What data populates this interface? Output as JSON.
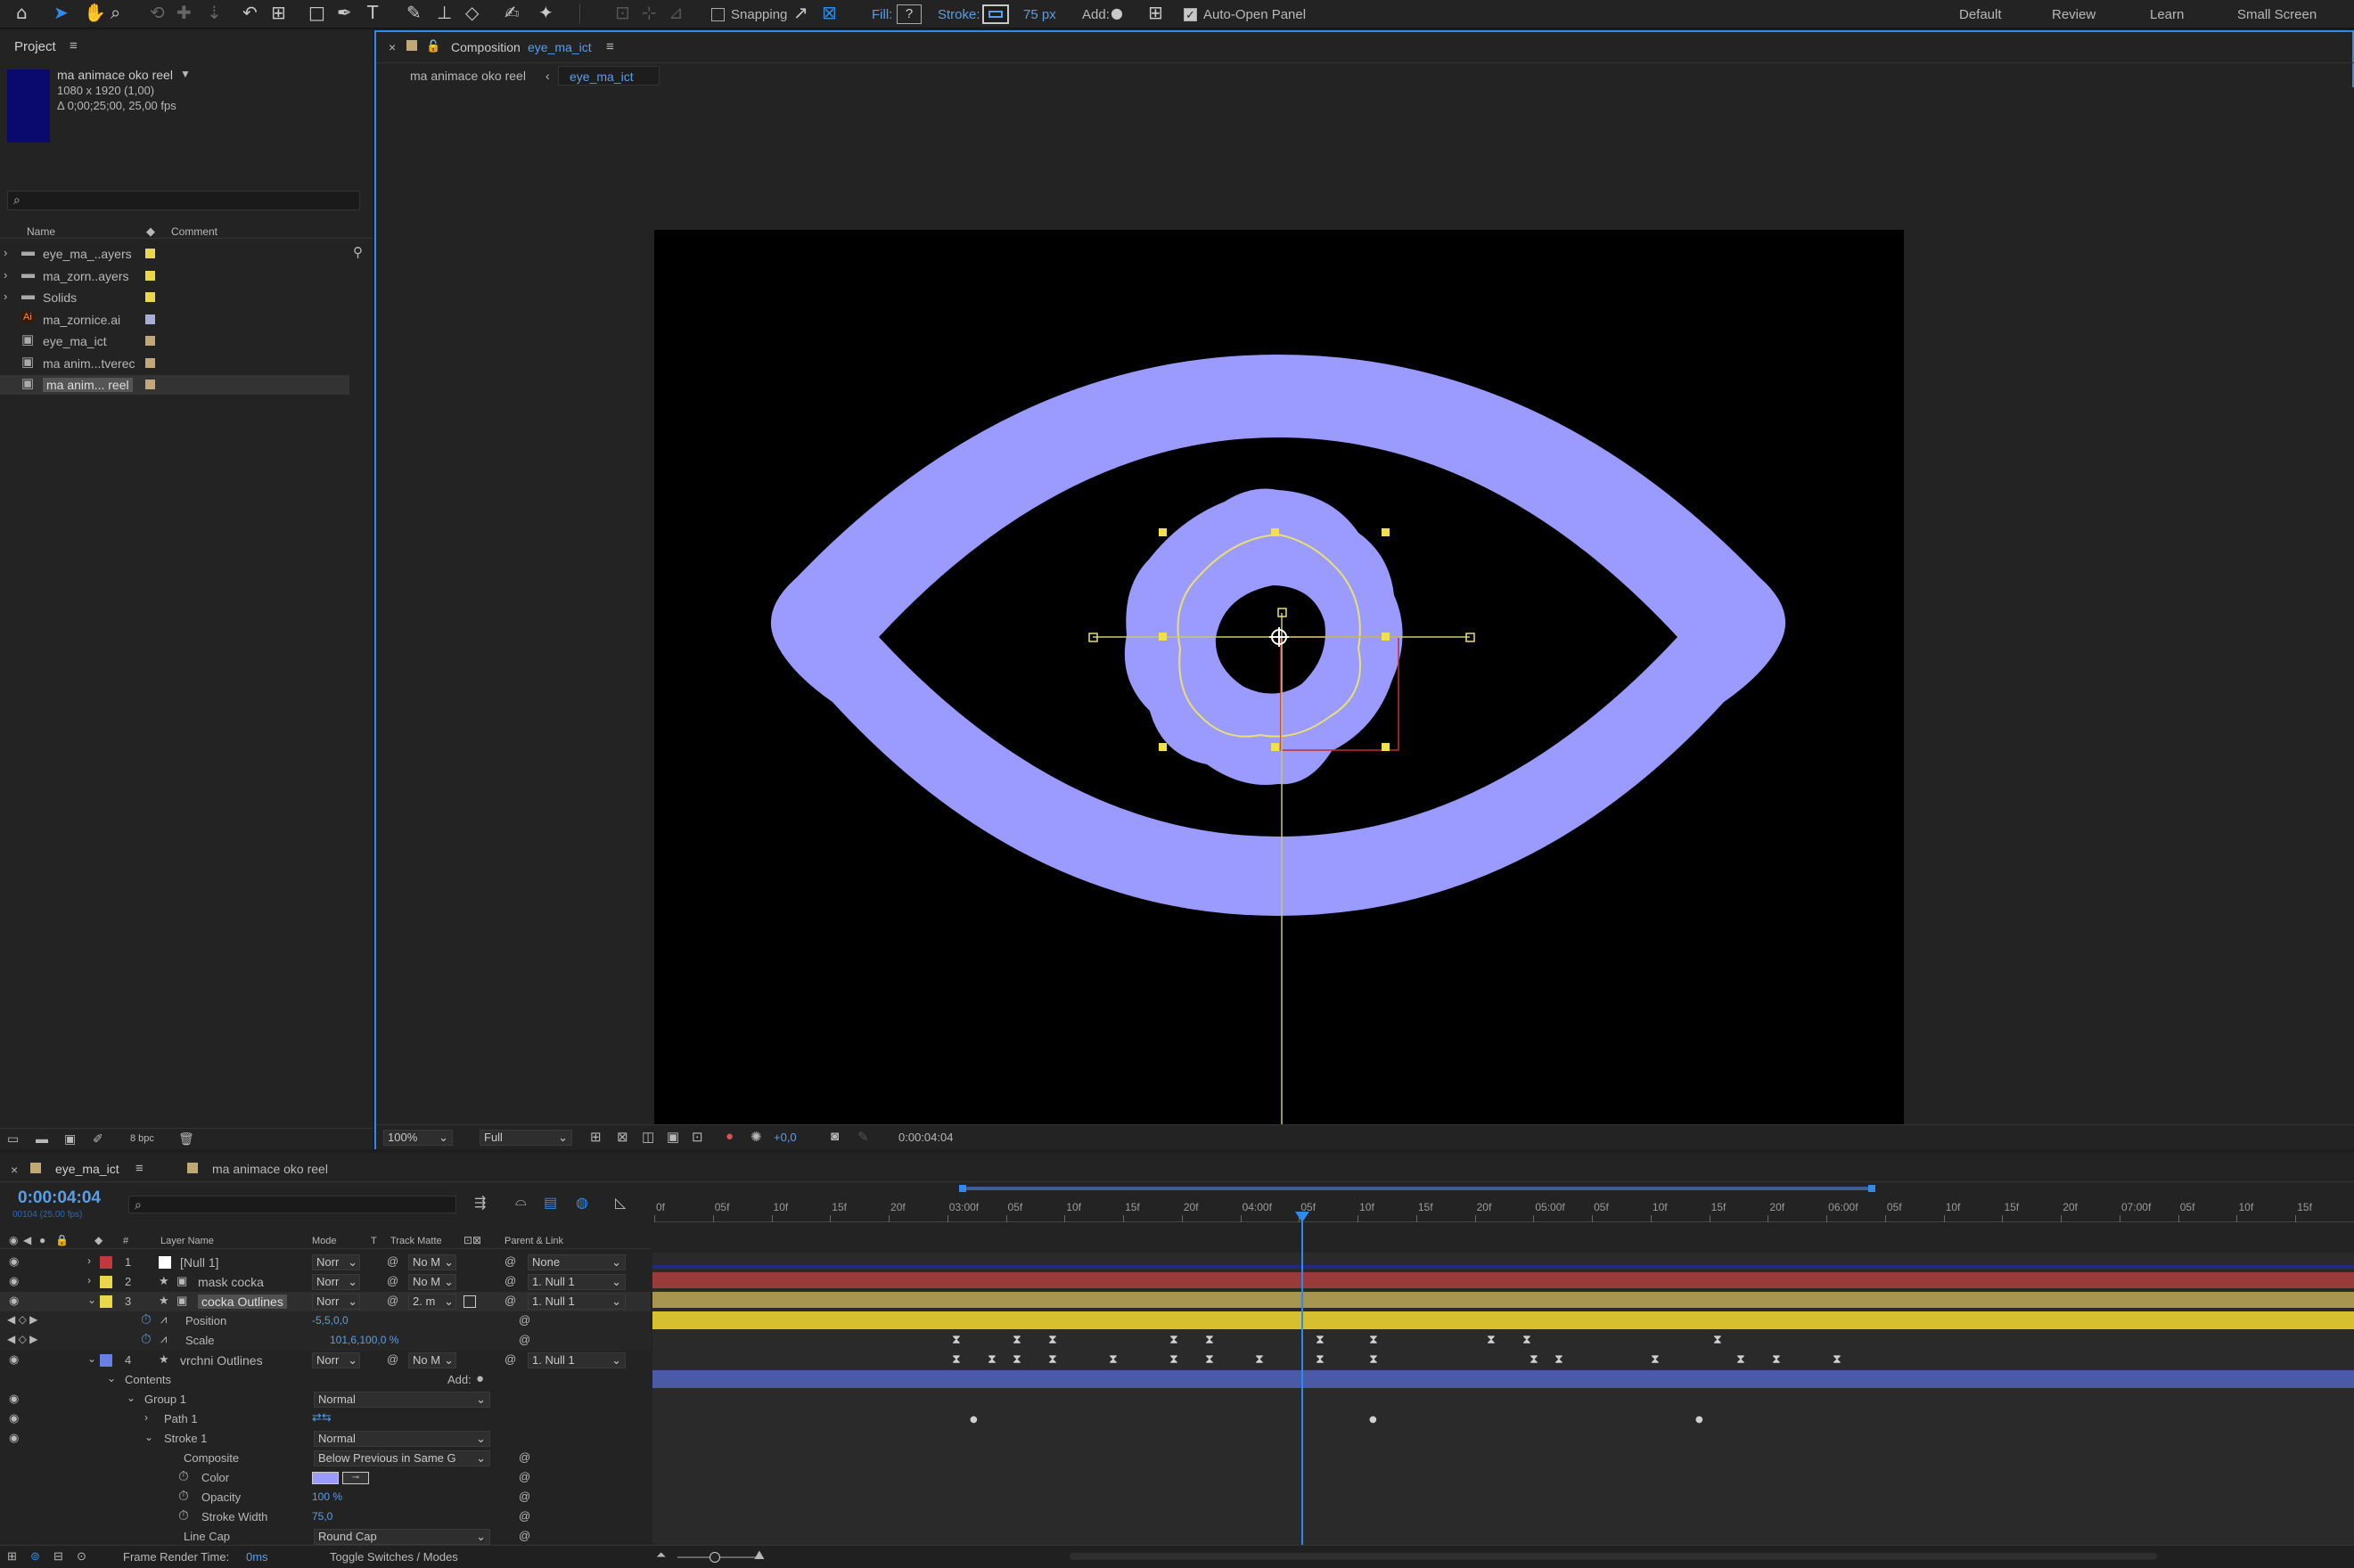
{
  "toolbar": {
    "snapping": "Snapping",
    "fill_label": "Fill:",
    "fill_value": "?",
    "stroke_label": "Stroke:",
    "stroke_width": "75 px",
    "add_label": "Add:",
    "auto_open": "Auto-Open Panel",
    "workspaces": [
      "Default",
      "Review",
      "Learn",
      "Small Screen"
    ]
  },
  "project": {
    "tab": "Project",
    "comp_name": "ma animace oko reel",
    "comp_size": "1080 x 1920 (1,00)",
    "comp_duration": "Δ 0;00;25;00, 25,00 fps",
    "col_name": "Name",
    "col_comment": "Comment",
    "items": [
      {
        "name": "eye_ma_..ayers",
        "type": "folder",
        "color": "#e8d84a"
      },
      {
        "name": "ma_zorn..ayers",
        "type": "folder",
        "color": "#e8d84a"
      },
      {
        "name": "Solids",
        "type": "folder",
        "color": "#e8d84a"
      },
      {
        "name": "ma_zornice.ai",
        "type": "ai",
        "color": "#a8aed8"
      },
      {
        "name": "eye_ma_ict",
        "type": "comp",
        "color": "#c2a878"
      },
      {
        "name": "ma anim...tverec",
        "type": "comp",
        "color": "#c2a878"
      },
      {
        "name": "ma anim... reel",
        "type": "comp",
        "color": "#c2a878"
      }
    ],
    "bpc": "8 bpc"
  },
  "viewer": {
    "tab_prefix": "Composition",
    "tab_comp": "eye_ma_ict",
    "crumb1": "ma animace oko reel",
    "crumb2": "eye_ma_ict",
    "zoom": "100%",
    "resolution": "Full",
    "exposure": "+0,0",
    "timecode": "0:00:04:04",
    "eye_color": "#9b9bff"
  },
  "timeline": {
    "tab1": "eye_ma_ict",
    "tab2": "ma animace oko reel",
    "current_time": "0:00:04:04",
    "fps_sub": "00104 (25.00 fps)",
    "headers": {
      "layer": "Layer Name",
      "mode": "Mode",
      "t": "T",
      "track": "Track Matte",
      "parent": "Parent & Link"
    },
    "ruler": [
      "0f",
      "05f",
      "10f",
      "15f",
      "20f",
      "03:00f",
      "05f",
      "10f",
      "15f",
      "20f",
      "04:00f",
      "05f",
      "10f",
      "15f",
      "20f",
      "05:00f",
      "05f",
      "10f",
      "15f",
      "20f",
      "06:00f",
      "05f",
      "10f",
      "15f",
      "20f",
      "07:00f",
      "05f",
      "10f",
      "15f"
    ],
    "layers": [
      {
        "num": "1",
        "name": "[Null 1]",
        "mode": "Norr",
        "track": "No M",
        "parent": "None",
        "color": "#c0393b"
      },
      {
        "num": "2",
        "name": "mask cocka",
        "mode": "Norr",
        "track": "No M",
        "parent": "1. Null 1",
        "color": "#e8d84a"
      },
      {
        "num": "3",
        "name": "cocka Outlines",
        "mode": "Norr",
        "track": "2. m",
        "parent": "1. Null 1",
        "color": "#e8d84a"
      },
      {
        "num": "4",
        "name": "vrchni Outlines",
        "mode": "Norr",
        "track": "No M",
        "parent": "1. Null 1",
        "color": "#6a7ee8"
      }
    ],
    "position_label": "Position",
    "position_value": "-5,5,0,0",
    "scale_label": "Scale",
    "scale_value": "101,6,100,0 %",
    "contents": "Contents",
    "add": "Add:",
    "group": "Group 1",
    "group_mode": "Normal",
    "path": "Path 1",
    "stroke": "Stroke 1",
    "stroke_mode": "Normal",
    "composite_label": "Composite",
    "composite_value": "Below Previous in Same G",
    "color_label": "Color",
    "opacity_label": "Opacity",
    "opacity_value": "100 %",
    "stroke_width_label": "Stroke Width",
    "stroke_width_value": "75,0",
    "line_cap_label": "Line Cap",
    "line_cap_value": "Round Cap",
    "frame_render": "Frame Render Time:",
    "frame_render_value": "0ms",
    "toggle": "Toggle Switches / Modes"
  }
}
